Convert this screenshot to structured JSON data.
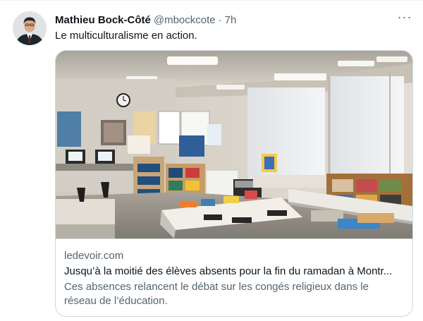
{
  "tweet": {
    "author_name": "Mathieu Bock-Côté",
    "handle": "@mbockcote",
    "separator": "·",
    "time": "7h",
    "more_label": "···",
    "text": "Le multiculturalisme en action."
  },
  "link_card": {
    "domain": "ledevoir.com",
    "title": "Jusqu’à la moitié des élèves absents pour la fin du ramadan à Montr...",
    "description": "Ces absences relancent le débat sur les congés religieux dans le réseau de l’éducation."
  },
  "colors": {
    "text_primary": "#0f1419",
    "text_secondary": "#536471",
    "border": "#cfd9de"
  },
  "icons": {
    "more": "more-horizontal-icon"
  }
}
